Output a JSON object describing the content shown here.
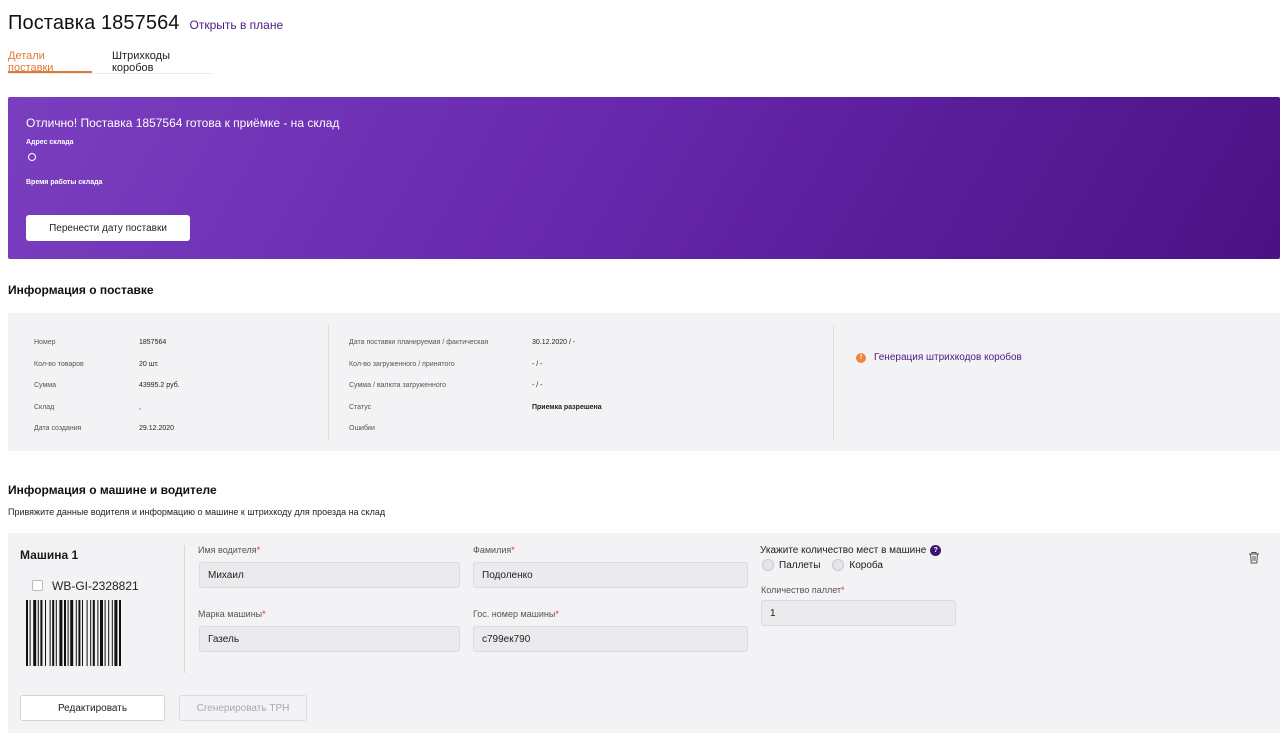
{
  "header": {
    "title": "Поставка 1857564",
    "open_in_plan": "Открыть в плане"
  },
  "tabs": [
    {
      "label": "Детали поставки",
      "active": true
    },
    {
      "label": "Штрихкоды коробов",
      "active": false
    }
  ],
  "banner": {
    "title": "Отлично! Поставка 1857564 готова к приёмке - на склад",
    "address_label": "Адрес склада",
    "hours_label": "Время работы склада",
    "reschedule_button": "Перенести дату поставки"
  },
  "info_section": {
    "title": "Информация о поставке",
    "col1": [
      {
        "key": "Номер",
        "value": "1857564"
      },
      {
        "key": "Кол-во товаров",
        "value": "20 шт."
      },
      {
        "key": "Сумма",
        "value": "43995.2 руб."
      },
      {
        "key": "Склад",
        "value": ","
      },
      {
        "key": "Дата создания",
        "value": "29.12.2020"
      }
    ],
    "col2": [
      {
        "key": "Дата поставки планируемая / фактическая",
        "value": "30.12.2020 / -"
      },
      {
        "key": "Кол-во загруженного / принятого",
        "value": "- / -"
      },
      {
        "key": "Сумма / валюта загруженного",
        "value": "- / -"
      },
      {
        "key": "Статус",
        "value": "Приемка разрешена"
      },
      {
        "key": "Ошибки",
        "value": ""
      }
    ],
    "barcode_gen_link": "Генерация штрихкодов коробов"
  },
  "car_section": {
    "title": "Информация о машине и водителе",
    "subtitle": "Привяжите данные водителя и информацию о машине к штрихкоду для проезда на склад",
    "car_name": "Машина 1",
    "car_code": "WB-GI-2328821",
    "fields": {
      "driver_name_label": "Имя водителя",
      "driver_name_value": "Михаил",
      "surname_label": "Фамилия",
      "surname_value": "Подоленко",
      "car_brand_label": "Марка машины",
      "car_brand_value": "Газель",
      "plate_label": "Гос. номер машины",
      "plate_value": "с799ек790",
      "pallets_count_label": "Количество паллет",
      "pallets_count_value": "1"
    },
    "seats_label": "Укажите количество мест в машине",
    "radio_pallets": "Паллеты",
    "radio_boxes": "Короба",
    "edit_button": "Редактировать",
    "trn_button": "Сгенерировать ТРН"
  },
  "colors": {
    "accent": "#e07a3a",
    "link": "#4a1a82",
    "banner_start": "#7a3fbf",
    "banner_end": "#4b1284"
  }
}
